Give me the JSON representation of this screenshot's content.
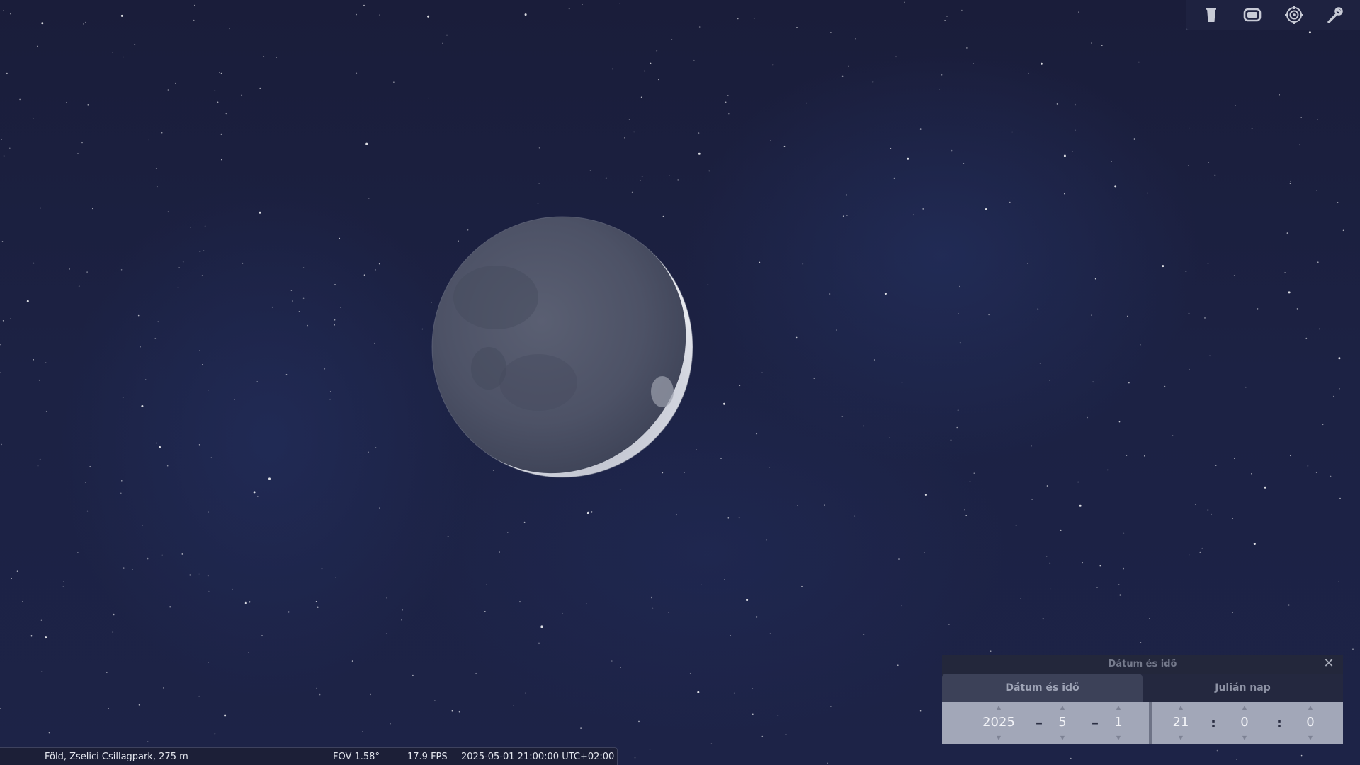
{
  "toolbar": {
    "items": [
      {
        "name": "trash-bin-icon",
        "tooltip": ""
      },
      {
        "name": "screen-icon",
        "tooltip": ""
      },
      {
        "name": "target-icon",
        "tooltip": ""
      },
      {
        "name": "wrench-icon",
        "tooltip": ""
      }
    ]
  },
  "statusbar": {
    "location": "Föld, Zselici Csillagpark, 275 m",
    "fov": "FOV 1.58°",
    "fps": "17.9 FPS",
    "datetime": "2025-05-01 21:00:00 UTC+02:00"
  },
  "dialog": {
    "title": "Dátum és idő",
    "close": "✕",
    "tabs": {
      "datetime": "Dátum és idő",
      "julian": "Julián nap"
    },
    "date": {
      "year": "2025",
      "month": "5",
      "day": "1",
      "sep": "–"
    },
    "time": {
      "hour": "21",
      "minute": "0",
      "second": "0",
      "sep": ":"
    },
    "arrow_up": "▲",
    "arrow_down": "▼"
  },
  "colors": {
    "sky": "#1c2244",
    "moon_lit": "#dfe2ea",
    "dialog_fields": "#a2a7b8"
  }
}
